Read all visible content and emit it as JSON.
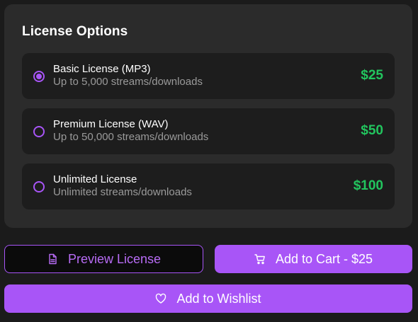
{
  "license": {
    "title": "License Options",
    "options": [
      {
        "name": "Basic License (MP3)",
        "description": "Up to 5,000 streams/downloads",
        "price": "$25",
        "selected": true
      },
      {
        "name": "Premium License (WAV)",
        "description": "Up to 50,000 streams/downloads",
        "price": "$50",
        "selected": false
      },
      {
        "name": "Unlimited License",
        "description": "Unlimited streams/downloads",
        "price": "$100",
        "selected": false
      }
    ]
  },
  "actions": {
    "preview_label": "Preview License",
    "cart_label": "Add to Cart - $25",
    "wishlist_label": "Add to Wishlist",
    "icons": {
      "preview": "document-icon",
      "cart": "cart-icon",
      "wishlist": "heart-icon"
    }
  },
  "colors": {
    "accent": "#a855f7",
    "price": "#22c55e",
    "panel": "#2b2b2b",
    "option_bg": "#1d1d1d"
  }
}
